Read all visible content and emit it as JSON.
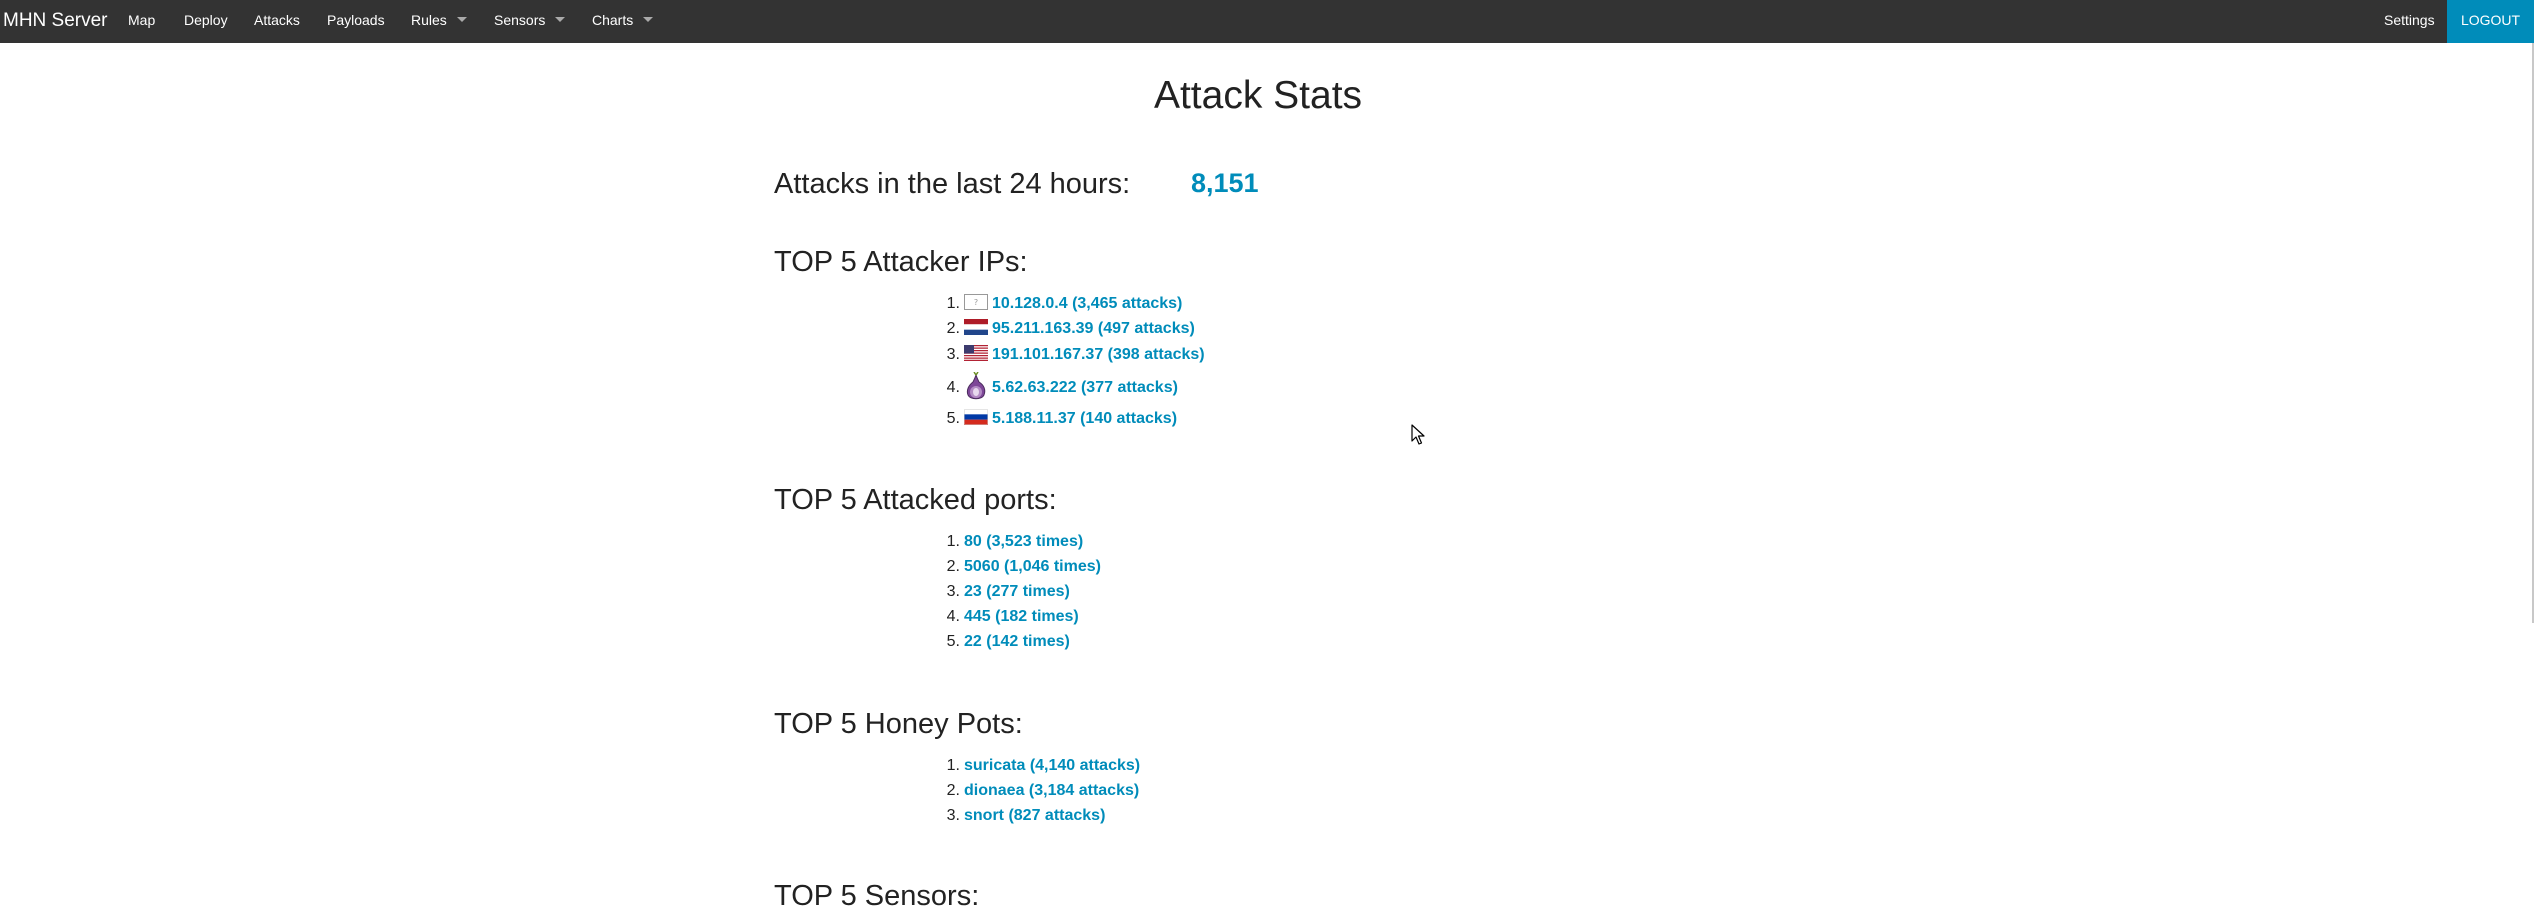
{
  "nav": {
    "brand": "MHN Server",
    "items": [
      {
        "label": "Map",
        "dropdown": false
      },
      {
        "label": "Deploy",
        "dropdown": false
      },
      {
        "label": "Attacks",
        "dropdown": false
      },
      {
        "label": "Payloads",
        "dropdown": false
      },
      {
        "label": "Rules",
        "dropdown": true
      },
      {
        "label": "Sensors",
        "dropdown": true
      },
      {
        "label": "Charts",
        "dropdown": true
      }
    ],
    "settings": "Settings",
    "logout": "LOGOUT",
    "colors": {
      "bar": "#333333",
      "logout_bg": "#008cba"
    }
  },
  "page": {
    "title": "Attack Stats",
    "attacks_label": "Attacks in the last 24 hours:",
    "attacks_count": "8,151",
    "link_color": "#008cba"
  },
  "attacker_ips": {
    "heading": "TOP 5 Attacker IPs:",
    "items": [
      {
        "num": "1.",
        "text": "10.128.0.4 (3,465 attacks)",
        "flag_icon": "unknown-flag-icon"
      },
      {
        "num": "2.",
        "text": "95.211.163.39 (497 attacks)",
        "flag_icon": "netherlands-flag-icon"
      },
      {
        "num": "3.",
        "text": "191.101.167.37 (398 attacks)",
        "flag_icon": "usa-flag-icon"
      },
      {
        "num": "4.",
        "text": "5.62.63.222 (377 attacks)",
        "flag_icon": "tor-onion-icon"
      },
      {
        "num": "5.",
        "text": "5.188.11.37 (140 attacks)",
        "flag_icon": "russia-flag-icon"
      }
    ]
  },
  "ports": {
    "heading": "TOP 5 Attacked ports:",
    "items": [
      {
        "num": "1.",
        "text": "80 (3,523 times)"
      },
      {
        "num": "2.",
        "text": "5060 (1,046 times)"
      },
      {
        "num": "3.",
        "text": "23 (277 times)"
      },
      {
        "num": "4.",
        "text": "445 (182 times)"
      },
      {
        "num": "5.",
        "text": "22 (142 times)"
      }
    ]
  },
  "honeypots": {
    "heading": "TOP 5 Honey Pots:",
    "items": [
      {
        "num": "1.",
        "text": "suricata (4,140 attacks)"
      },
      {
        "num": "2.",
        "text": "dionaea (3,184 attacks)"
      },
      {
        "num": "3.",
        "text": "snort (827 attacks)"
      }
    ]
  },
  "sensors": {
    "heading": "TOP 5 Sensors:"
  }
}
